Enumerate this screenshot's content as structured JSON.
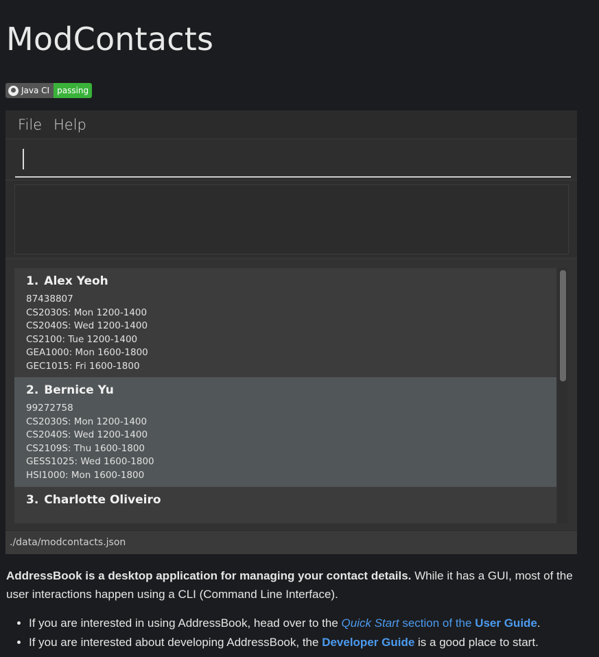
{
  "page": {
    "title": "ModContacts",
    "badge": {
      "label": "Java CI",
      "status": "passing",
      "icon": "github-icon",
      "status_color": "#3ab23a"
    }
  },
  "app": {
    "menu": [
      "File",
      "Help"
    ],
    "command_input": {
      "value": "",
      "placeholder": ""
    },
    "result_text": "",
    "persons": [
      {
        "index": "1.",
        "name": "Alex Yeoh",
        "phone": "87438807",
        "modules": [
          "CS2030S: Mon 1200-1400",
          "CS2040S: Wed 1200-1400",
          "CS2100: Tue 1200-1400",
          "GEA1000: Mon 1600-1800",
          "GEC1015: Fri 1600-1800"
        ]
      },
      {
        "index": "2.",
        "name": "Bernice Yu",
        "phone": "99272758",
        "modules": [
          "CS2030S: Mon 1200-1400",
          "CS2040S: Wed 1200-1400",
          "CS2109S: Thu 1600-1800",
          "GESS1025: Wed 1600-1800",
          "HSI1000: Mon 1600-1800"
        ]
      },
      {
        "index": "3.",
        "name": "Charlotte Oliveiro",
        "phone": "",
        "modules": []
      }
    ],
    "status_path": "./data/modcontacts.json"
  },
  "description": {
    "bold": "AddressBook is a desktop application for managing your contact details.",
    "rest": " While it has a GUI, most of the user interactions happen using a CLI (Command Line Interface).",
    "bullet1": {
      "pre": "If you are interested in using AddressBook, head over to the ",
      "quick_start": "Quick Start",
      "mid": " section of the ",
      "user_guide": "User Guide",
      "post": "."
    },
    "bullet2": {
      "pre": "If you are interested about developing AddressBook, the ",
      "developer_guide": "Developer Guide",
      "post": " is a good place to start."
    }
  }
}
